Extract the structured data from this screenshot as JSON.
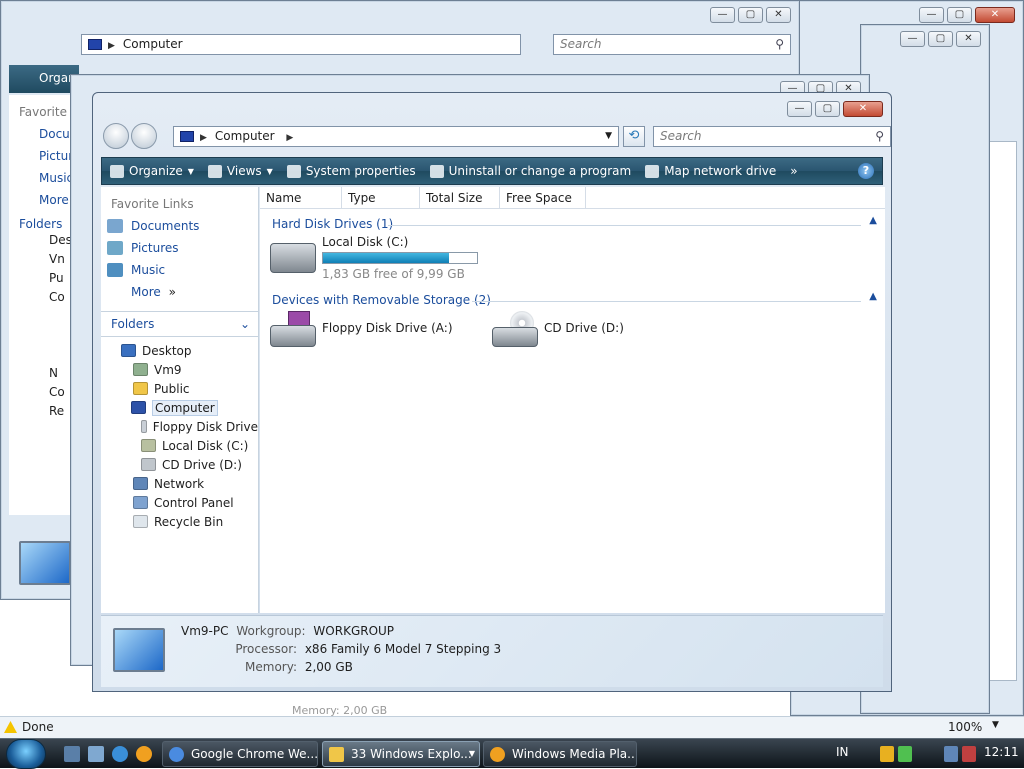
{
  "main_window": {
    "address": {
      "location": "Computer"
    },
    "search_placeholder": "Search",
    "toolbar": {
      "organize": "Organize",
      "views": "Views",
      "system_properties": "System properties",
      "uninstall": "Uninstall or change a program",
      "map_drive": "Map network drive",
      "overflow": "»"
    },
    "favorite_links": {
      "title": "Favorite Links",
      "items": [
        {
          "label": "Documents",
          "icon": "documents-icon"
        },
        {
          "label": "Pictures",
          "icon": "pictures-icon"
        },
        {
          "label": "Music",
          "icon": "music-icon"
        }
      ],
      "more": "More"
    },
    "folders": {
      "title": "Folders",
      "tree": [
        {
          "label": "Desktop",
          "icon": "desktop-icon",
          "level": 0
        },
        {
          "label": "Vm9",
          "icon": "user-folder-icon",
          "level": 1
        },
        {
          "label": "Public",
          "icon": "folder-icon",
          "level": 1
        },
        {
          "label": "Computer",
          "icon": "computer-icon",
          "level": 1,
          "selected": true
        },
        {
          "label": "Floppy Disk Drive",
          "icon": "floppy-icon",
          "level": 2
        },
        {
          "label": "Local Disk (C:)",
          "icon": "hard-disk-icon",
          "level": 2
        },
        {
          "label": "CD Drive (D:)",
          "icon": "cd-drive-icon",
          "level": 2
        },
        {
          "label": "Network",
          "icon": "network-icon",
          "level": 1
        },
        {
          "label": "Control Panel",
          "icon": "control-panel-icon",
          "level": 1
        },
        {
          "label": "Recycle Bin",
          "icon": "recycle-bin-icon",
          "level": 1
        }
      ]
    },
    "columns": [
      "Name",
      "Type",
      "Total Size",
      "Free Space"
    ],
    "groups": {
      "hard_disk": {
        "title": "Hard Disk Drives (1)",
        "drive": {
          "name": "Local Disk (C:)",
          "free_text": "1,83 GB free of 9,99 GB",
          "used_fraction": 0.82
        }
      },
      "removable": {
        "title": "Devices with Removable Storage (2)",
        "floppy": "Floppy Disk Drive (A:)",
        "cd": "CD Drive (D:)"
      }
    },
    "details": {
      "pc_name": "Vm9-PC",
      "workgroup_label": "Workgroup:",
      "workgroup": "WORKGROUP",
      "processor_label": "Processor:",
      "processor": "x86 Family 6 Model 7 Stepping 3",
      "memory_label": "Memory:",
      "memory": "2,00 GB"
    }
  },
  "background": {
    "address": "Computer",
    "search": "Search",
    "organize": "Organ",
    "fav_title": "Favorite L",
    "fav_items": [
      "Docum",
      "Pictur",
      "Music"
    ],
    "more": "More",
    "folders": "Folders",
    "tree": [
      "Des",
      "Vn",
      "Pu",
      "Co",
      "N",
      "Co",
      "Re"
    ],
    "stray_memory": "Memory:  2,00 GB"
  },
  "statusbar": {
    "text": "Done",
    "zoom": "100%"
  },
  "taskbar": {
    "tasks": [
      "Google Chrome We...",
      "33 Windows Explo...",
      "Windows Media Pla..."
    ],
    "language": "IN",
    "clock": "12:11"
  },
  "colors": {
    "accent": "#1b4d9c",
    "toolbar": "#2a5570",
    "progress": "#1796c8"
  }
}
